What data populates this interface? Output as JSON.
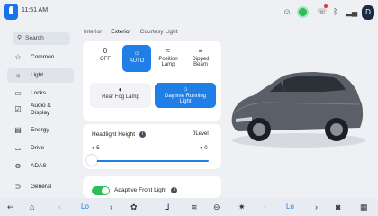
{
  "status": {
    "time": "11:51 AM",
    "avatar_letter": "D",
    "icons": [
      "mic-icon",
      "person-icon",
      "green-status-icon",
      "phone-icon",
      "bluetooth-icon",
      "signal-icon",
      "avatar-icon"
    ]
  },
  "sidebar": {
    "search_label": "Search",
    "items": [
      {
        "label": "Common",
        "icon": "star-icon"
      },
      {
        "label": "Light",
        "icon": "sun-icon",
        "active": true
      },
      {
        "label": "Locks",
        "icon": "lock-icon"
      },
      {
        "label": "Audio &",
        "label2": "Display",
        "icon": "audio-display-icon"
      },
      {
        "label": "Energy",
        "icon": "battery-icon"
      },
      {
        "label": "Drive",
        "icon": "car-icon"
      },
      {
        "label": "ADAS",
        "icon": "steering-icon"
      },
      {
        "label": "General",
        "icon": "general-icon"
      }
    ]
  },
  "tabs": [
    {
      "label": "Interior"
    },
    {
      "label": "Exterior",
      "active": true
    },
    {
      "label": "Courtesy Light"
    }
  ],
  "light_modes": [
    {
      "label": "OFF",
      "value": "0"
    },
    {
      "label": "AUTO",
      "active": true
    },
    {
      "label": "Position",
      "label2": "Lamp"
    },
    {
      "label": "Dipped",
      "label2": "Beam"
    }
  ],
  "fog": {
    "rear_label": "Rear Fog Lamp",
    "drl_label1": "Daytime Running",
    "drl_label2": "Light"
  },
  "headlight": {
    "title": "Headlight Height",
    "level_label": "0Level",
    "min": "5",
    "max": "0",
    "slider_fraction": 0.0
  },
  "adaptive": {
    "label": "Adaptive Front Light",
    "enabled": true
  },
  "bottombar": {
    "left_temp": "Lo",
    "right_temp": "Lo"
  },
  "colors": {
    "accent": "#1f7fe6",
    "toggle_on": "#2ebd59",
    "background": "#eef0f4"
  }
}
